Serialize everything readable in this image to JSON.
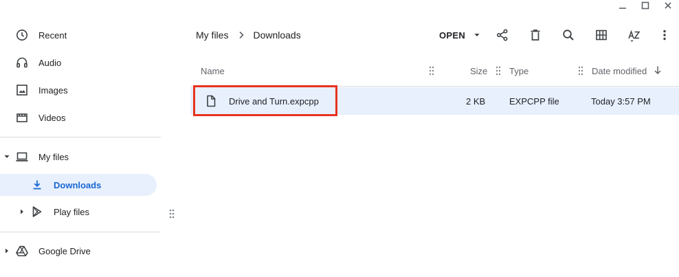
{
  "sidebar": {
    "items": [
      {
        "label": "Recent",
        "icon": "clock-icon"
      },
      {
        "label": "Audio",
        "icon": "headphones-icon"
      },
      {
        "label": "Images",
        "icon": "image-icon"
      },
      {
        "label": "Videos",
        "icon": "film-icon"
      },
      {
        "label": "My files",
        "icon": "laptop-icon"
      },
      {
        "label": "Downloads",
        "icon": "download-icon"
      },
      {
        "label": "Play files",
        "icon": "play-store-icon"
      },
      {
        "label": "Google Drive",
        "icon": "google-drive-icon"
      }
    ]
  },
  "breadcrumb": {
    "root": "My files",
    "current": "Downloads"
  },
  "toolbar": {
    "open_label": "OPEN"
  },
  "table": {
    "columns": {
      "name": "Name",
      "size": "Size",
      "type": "Type",
      "date": "Date modified"
    },
    "rows": [
      {
        "name": "Drive and Turn.expcpp",
        "size": "2 KB",
        "type": "EXPCPP file",
        "date": "Today 3:57 PM"
      }
    ]
  },
  "colors": {
    "accent": "#1967d2",
    "selection": "#e8f0fe",
    "highlight": "#e8321e"
  }
}
